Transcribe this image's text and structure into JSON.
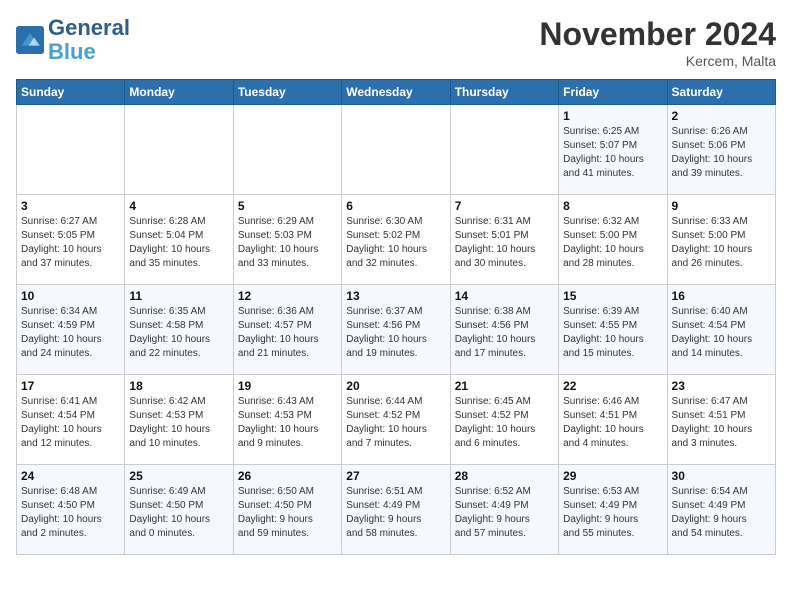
{
  "header": {
    "logo_line1": "General",
    "logo_line2": "Blue",
    "month": "November 2024",
    "location": "Kercem, Malta"
  },
  "weekdays": [
    "Sunday",
    "Monday",
    "Tuesday",
    "Wednesday",
    "Thursday",
    "Friday",
    "Saturday"
  ],
  "weeks": [
    [
      {
        "day": "",
        "info": ""
      },
      {
        "day": "",
        "info": ""
      },
      {
        "day": "",
        "info": ""
      },
      {
        "day": "",
        "info": ""
      },
      {
        "day": "",
        "info": ""
      },
      {
        "day": "1",
        "info": "Sunrise: 6:25 AM\nSunset: 5:07 PM\nDaylight: 10 hours\nand 41 minutes."
      },
      {
        "day": "2",
        "info": "Sunrise: 6:26 AM\nSunset: 5:06 PM\nDaylight: 10 hours\nand 39 minutes."
      }
    ],
    [
      {
        "day": "3",
        "info": "Sunrise: 6:27 AM\nSunset: 5:05 PM\nDaylight: 10 hours\nand 37 minutes."
      },
      {
        "day": "4",
        "info": "Sunrise: 6:28 AM\nSunset: 5:04 PM\nDaylight: 10 hours\nand 35 minutes."
      },
      {
        "day": "5",
        "info": "Sunrise: 6:29 AM\nSunset: 5:03 PM\nDaylight: 10 hours\nand 33 minutes."
      },
      {
        "day": "6",
        "info": "Sunrise: 6:30 AM\nSunset: 5:02 PM\nDaylight: 10 hours\nand 32 minutes."
      },
      {
        "day": "7",
        "info": "Sunrise: 6:31 AM\nSunset: 5:01 PM\nDaylight: 10 hours\nand 30 minutes."
      },
      {
        "day": "8",
        "info": "Sunrise: 6:32 AM\nSunset: 5:00 PM\nDaylight: 10 hours\nand 28 minutes."
      },
      {
        "day": "9",
        "info": "Sunrise: 6:33 AM\nSunset: 5:00 PM\nDaylight: 10 hours\nand 26 minutes."
      }
    ],
    [
      {
        "day": "10",
        "info": "Sunrise: 6:34 AM\nSunset: 4:59 PM\nDaylight: 10 hours\nand 24 minutes."
      },
      {
        "day": "11",
        "info": "Sunrise: 6:35 AM\nSunset: 4:58 PM\nDaylight: 10 hours\nand 22 minutes."
      },
      {
        "day": "12",
        "info": "Sunrise: 6:36 AM\nSunset: 4:57 PM\nDaylight: 10 hours\nand 21 minutes."
      },
      {
        "day": "13",
        "info": "Sunrise: 6:37 AM\nSunset: 4:56 PM\nDaylight: 10 hours\nand 19 minutes."
      },
      {
        "day": "14",
        "info": "Sunrise: 6:38 AM\nSunset: 4:56 PM\nDaylight: 10 hours\nand 17 minutes."
      },
      {
        "day": "15",
        "info": "Sunrise: 6:39 AM\nSunset: 4:55 PM\nDaylight: 10 hours\nand 15 minutes."
      },
      {
        "day": "16",
        "info": "Sunrise: 6:40 AM\nSunset: 4:54 PM\nDaylight: 10 hours\nand 14 minutes."
      }
    ],
    [
      {
        "day": "17",
        "info": "Sunrise: 6:41 AM\nSunset: 4:54 PM\nDaylight: 10 hours\nand 12 minutes."
      },
      {
        "day": "18",
        "info": "Sunrise: 6:42 AM\nSunset: 4:53 PM\nDaylight: 10 hours\nand 10 minutes."
      },
      {
        "day": "19",
        "info": "Sunrise: 6:43 AM\nSunset: 4:53 PM\nDaylight: 10 hours\nand 9 minutes."
      },
      {
        "day": "20",
        "info": "Sunrise: 6:44 AM\nSunset: 4:52 PM\nDaylight: 10 hours\nand 7 minutes."
      },
      {
        "day": "21",
        "info": "Sunrise: 6:45 AM\nSunset: 4:52 PM\nDaylight: 10 hours\nand 6 minutes."
      },
      {
        "day": "22",
        "info": "Sunrise: 6:46 AM\nSunset: 4:51 PM\nDaylight: 10 hours\nand 4 minutes."
      },
      {
        "day": "23",
        "info": "Sunrise: 6:47 AM\nSunset: 4:51 PM\nDaylight: 10 hours\nand 3 minutes."
      }
    ],
    [
      {
        "day": "24",
        "info": "Sunrise: 6:48 AM\nSunset: 4:50 PM\nDaylight: 10 hours\nand 2 minutes."
      },
      {
        "day": "25",
        "info": "Sunrise: 6:49 AM\nSunset: 4:50 PM\nDaylight: 10 hours\nand 0 minutes."
      },
      {
        "day": "26",
        "info": "Sunrise: 6:50 AM\nSunset: 4:50 PM\nDaylight: 9 hours\nand 59 minutes."
      },
      {
        "day": "27",
        "info": "Sunrise: 6:51 AM\nSunset: 4:49 PM\nDaylight: 9 hours\nand 58 minutes."
      },
      {
        "day": "28",
        "info": "Sunrise: 6:52 AM\nSunset: 4:49 PM\nDaylight: 9 hours\nand 57 minutes."
      },
      {
        "day": "29",
        "info": "Sunrise: 6:53 AM\nSunset: 4:49 PM\nDaylight: 9 hours\nand 55 minutes."
      },
      {
        "day": "30",
        "info": "Sunrise: 6:54 AM\nSunset: 4:49 PM\nDaylight: 9 hours\nand 54 minutes."
      }
    ]
  ]
}
